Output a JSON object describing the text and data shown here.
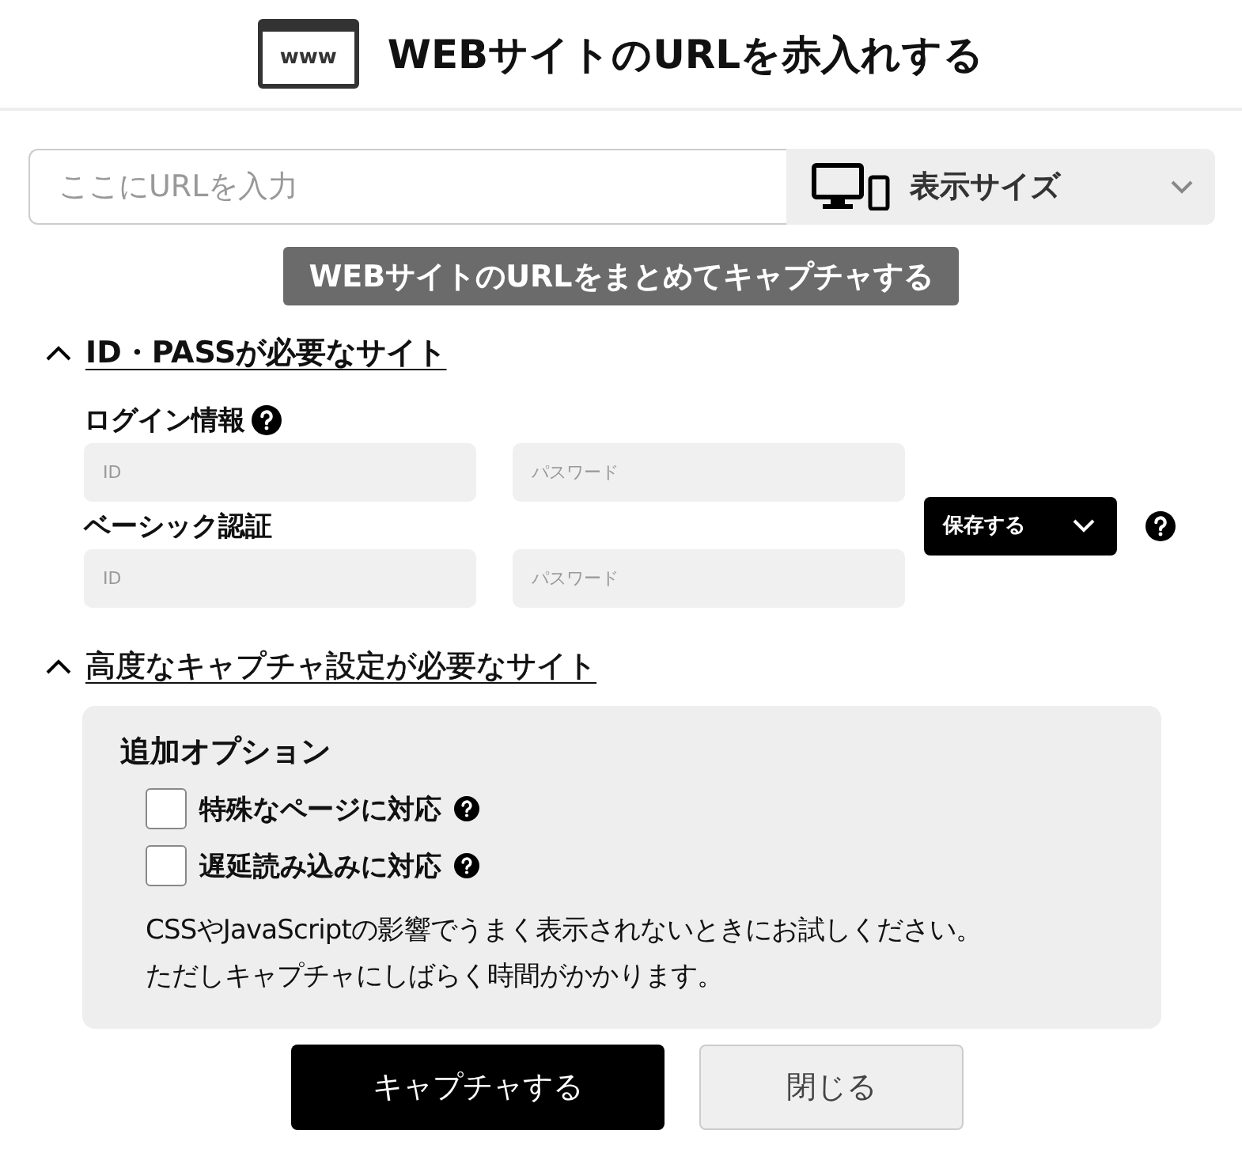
{
  "header": {
    "icon_label": "www",
    "title": "WEBサイトのURLを赤入れする"
  },
  "url_input": {
    "placeholder": "ここにURLを入力"
  },
  "display_size": {
    "label": "表示サイズ"
  },
  "bulk_capture_button": "WEBサイトのURLをまとめてキャプチャする",
  "auth_section": {
    "heading": "ID・PASSが必要なサイト",
    "expanded": true,
    "groups": [
      {
        "label": "ログイン情報",
        "help": true,
        "id_placeholder": "ID",
        "password_placeholder": "パスワード"
      },
      {
        "label": "ベーシック認証",
        "help": false,
        "id_placeholder": "ID",
        "password_placeholder": "パスワード"
      }
    ],
    "save_button": "保存する"
  },
  "advanced_section": {
    "heading": "高度なキャプチャ設定が必要なサイト",
    "expanded": true,
    "panel_title": "追加オプション",
    "options": [
      {
        "label": "特殊なページに対応",
        "checked": false
      },
      {
        "label": "遅延読み込みに対応",
        "checked": false
      }
    ],
    "note_lines": [
      "CSSやJavaScriptの影響でうまく表示されないときにお試しください。",
      "ただしキャプチャにしばらく時間がかかります。"
    ]
  },
  "buttons": [
    {
      "label": "キャプチャする",
      "kind": "primary"
    },
    {
      "label": "閉じる",
      "kind": "secondary"
    }
  ]
}
